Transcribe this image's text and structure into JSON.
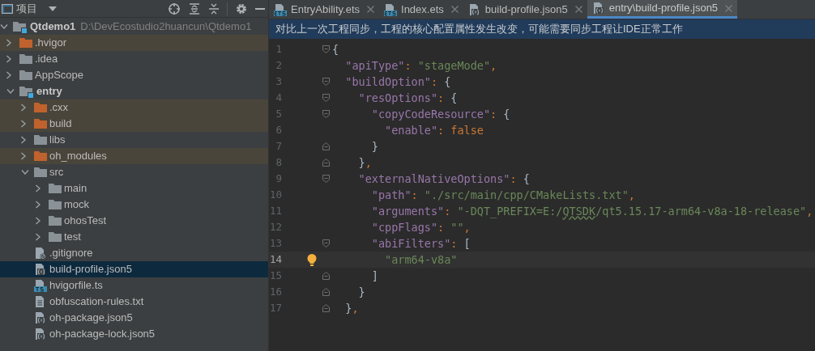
{
  "project_panel": {
    "title": "项目",
    "tree": [
      {
        "label": "Qtdemo1",
        "path": "D:\\DevEcostudio2huancun\\Qtdemo1",
        "kind": "module",
        "expanded": true,
        "children": [
          {
            "label": ".hvigor",
            "kind": "folder",
            "expanded": false,
            "excluded": true
          },
          {
            "label": ".idea",
            "kind": "folder",
            "expanded": false,
            "excluded": false
          },
          {
            "label": "AppScope",
            "kind": "folder",
            "expanded": false,
            "excluded": false
          },
          {
            "label": "entry",
            "kind": "module",
            "expanded": true,
            "children": [
              {
                "label": ".cxx",
                "kind": "folder",
                "expanded": false,
                "excluded": true
              },
              {
                "label": "build",
                "kind": "folder",
                "expanded": false,
                "excluded": true
              },
              {
                "label": "libs",
                "kind": "folder",
                "expanded": false,
                "excluded": false
              },
              {
                "label": "oh_modules",
                "kind": "folder",
                "expanded": false,
                "excluded": true
              },
              {
                "label": "src",
                "kind": "folder",
                "expanded": true,
                "excluded": false,
                "children": [
                  {
                    "label": "main",
                    "kind": "folder",
                    "expanded": false,
                    "excluded": false
                  },
                  {
                    "label": "mock",
                    "kind": "folder",
                    "expanded": false,
                    "excluded": false
                  },
                  {
                    "label": "ohosTest",
                    "kind": "folder",
                    "expanded": false,
                    "excluded": false
                  },
                  {
                    "label": "test",
                    "kind": "folder",
                    "expanded": false,
                    "excluded": false
                  }
                ]
              },
              {
                "label": ".gitignore",
                "kind": "ignore",
                "selected": false
              },
              {
                "label": "build-profile.json5",
                "kind": "json",
                "selected": true
              },
              {
                "label": "hvigorfile.ts",
                "kind": "ts",
                "selected": false
              },
              {
                "label": "obfuscation-rules.txt",
                "kind": "text",
                "selected": false
              },
              {
                "label": "oh-package.json5",
                "kind": "json",
                "selected": false
              },
              {
                "label": "oh-package-lock.json5",
                "kind": "json",
                "selected": false
              }
            ]
          }
        ]
      }
    ]
  },
  "tabs": [
    {
      "label": "EntryAbility.ets",
      "kind": "ets",
      "selected": false
    },
    {
      "label": "Index.ets",
      "kind": "ets",
      "selected": false
    },
    {
      "label": "build-profile.json5",
      "kind": "json",
      "selected": false
    },
    {
      "label": "entry\\build-profile.json5",
      "kind": "json",
      "selected": true
    }
  ],
  "notification": "对比上一次工程同步，工程的核心配置属性发生改变，可能需要同步工程让IDE正常工作",
  "editor": {
    "lines": [
      {
        "number": "1",
        "kind": "opener",
        "current": false,
        "tokens": [
          {
            "kind": "brace",
            "text": "{"
          }
        ]
      },
      {
        "number": "2",
        "kind": "plain",
        "current": false,
        "tokens": [
          {
            "kind": "key",
            "text": "  \"apiType\""
          },
          {
            "kind": "punct",
            "text": ": "
          },
          {
            "kind": "string",
            "text": "\"stageMode\""
          },
          {
            "kind": "punct",
            "text": ","
          }
        ]
      },
      {
        "number": "3",
        "kind": "opener",
        "current": false,
        "tokens": [
          {
            "kind": "key",
            "text": "  \"buildOption\""
          },
          {
            "kind": "punct",
            "text": ": "
          },
          {
            "kind": "brace",
            "text": "{"
          }
        ]
      },
      {
        "number": "4",
        "kind": "opener",
        "current": false,
        "tokens": [
          {
            "kind": "key",
            "text": "    \"resOptions\""
          },
          {
            "kind": "punct",
            "text": ": "
          },
          {
            "kind": "brace",
            "text": "{"
          }
        ]
      },
      {
        "number": "5",
        "kind": "opener",
        "current": false,
        "tokens": [
          {
            "kind": "key",
            "text": "      \"copyCodeResource\""
          },
          {
            "kind": "punct",
            "text": ": "
          },
          {
            "kind": "brace",
            "text": "{"
          }
        ]
      },
      {
        "number": "6",
        "kind": "plain",
        "current": false,
        "tokens": [
          {
            "kind": "key",
            "text": "        \"enable\""
          },
          {
            "kind": "punct",
            "text": ": "
          },
          {
            "kind": "keyword",
            "text": "false"
          }
        ]
      },
      {
        "number": "7",
        "kind": "closer",
        "current": false,
        "tokens": [
          {
            "kind": "brace",
            "text": "      }"
          }
        ]
      },
      {
        "number": "8",
        "kind": "closer",
        "current": false,
        "tokens": [
          {
            "kind": "brace",
            "text": "    }"
          },
          {
            "kind": "punct",
            "text": ","
          }
        ]
      },
      {
        "number": "9",
        "kind": "opener",
        "current": false,
        "tokens": [
          {
            "kind": "key",
            "text": "    \"externalNativeOptions\""
          },
          {
            "kind": "punct",
            "text": ": "
          },
          {
            "kind": "brace",
            "text": "{"
          }
        ]
      },
      {
        "number": "10",
        "kind": "plain",
        "current": false,
        "tokens": [
          {
            "kind": "key",
            "text": "      \"path\""
          },
          {
            "kind": "punct",
            "text": ": "
          },
          {
            "kind": "string",
            "text": "\"./src/main/cpp/CMakeLists.txt\""
          },
          {
            "kind": "punct",
            "text": ","
          }
        ]
      },
      {
        "number": "11",
        "kind": "plain",
        "current": false,
        "tokens": [
          {
            "kind": "key",
            "text": "      \"arguments\""
          },
          {
            "kind": "punct",
            "text": ": "
          },
          {
            "kind": "string",
            "text": "\"-DQT_PREFIX=E:/"
          },
          {
            "kind": "typo",
            "text": "QTSDK"
          },
          {
            "kind": "string",
            "text": "/qt5.15.17-arm64-v8a-18-release\""
          },
          {
            "kind": "punct",
            "text": ","
          }
        ]
      },
      {
        "number": "12",
        "kind": "plain",
        "current": false,
        "tokens": [
          {
            "kind": "key",
            "text": "      \"cppFlags\""
          },
          {
            "kind": "punct",
            "text": ": "
          },
          {
            "kind": "string",
            "text": "\"\""
          },
          {
            "kind": "punct",
            "text": ","
          }
        ]
      },
      {
        "number": "13",
        "kind": "opener",
        "current": false,
        "tokens": [
          {
            "kind": "key",
            "text": "      \"abiFilters\""
          },
          {
            "kind": "punct",
            "text": ": "
          },
          {
            "kind": "brace",
            "text": "["
          }
        ]
      },
      {
        "number": "14",
        "kind": "plain",
        "current": true,
        "hint": true,
        "tokens": [
          {
            "kind": "string",
            "text": "        \"arm64-v8a\""
          }
        ]
      },
      {
        "number": "15",
        "kind": "closer",
        "current": false,
        "tokens": [
          {
            "kind": "brace",
            "text": "      ]"
          }
        ]
      },
      {
        "number": "16",
        "kind": "closer",
        "current": false,
        "tokens": [
          {
            "kind": "brace",
            "text": "    }"
          }
        ]
      },
      {
        "number": "17",
        "kind": "closer",
        "current": false,
        "tokens": [
          {
            "kind": "brace",
            "text": "  }"
          },
          {
            "kind": "punct",
            "text": ","
          }
        ]
      }
    ]
  }
}
